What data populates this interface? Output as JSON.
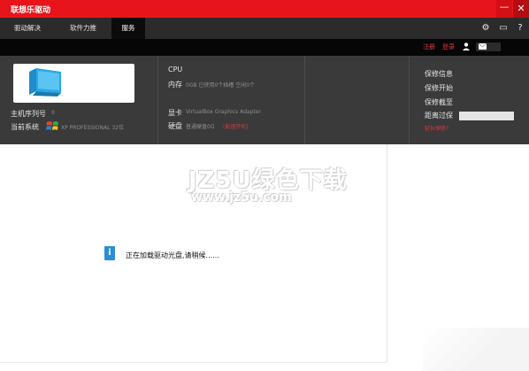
{
  "window": {
    "title": "联想乐驱动",
    "minimize_glyph": "—",
    "close_glyph": "✕"
  },
  "tabs": [
    {
      "label": "驱动解决"
    },
    {
      "label": "软件力推"
    },
    {
      "label": "服务"
    }
  ],
  "toolbar_icons": [
    "gear-icon",
    "chat-icon",
    "help-icon"
  ],
  "toolbar_glyphs": {
    "gear": "⚙",
    "chat": "▭",
    "help": "?"
  },
  "user": {
    "register": "注册",
    "login": "登录"
  },
  "system": {
    "serial_label": "主机序列号",
    "serial_value": "0",
    "os_label": "当前系统",
    "os_value": "XP PROFESSIONAL 32位",
    "cpu_label": "CPU",
    "memory_label": "内存",
    "memory_value": "0GB 已使用0个插槽 空闲0个",
    "gpu_label": "显卡",
    "gpu_value": "VirtualBox Graphics Adapter",
    "disk_label": "硬盘",
    "disk_value": "普通硬盘0G",
    "disk_link": "(影速开机)"
  },
  "warranty": {
    "info": "保修信息",
    "start": "保修开始",
    "end": "保修截至",
    "remaining": "距离过保",
    "extend": "延长保修?"
  },
  "loading": {
    "icon": "i",
    "text": "正在加载驱动光盘,请稍候......"
  },
  "watermark": {
    "main": "JZ5U绿色下载",
    "sub": "www.jz5u.com"
  },
  "colors": {
    "brand_red": "#e8141b",
    "nav_dark": "#2b2b2b",
    "panel_gray": "#3a3a3a",
    "link_red": "#d9363e",
    "info_blue": "#2b8fd4",
    "pc_blue": "#29a9e6"
  }
}
